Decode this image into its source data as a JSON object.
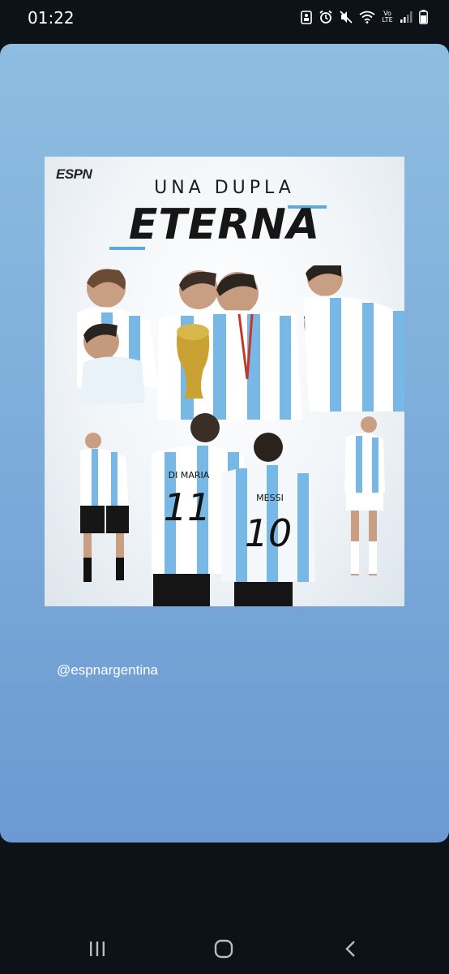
{
  "status_bar": {
    "time": "01:22",
    "network_label": "Vo LTE",
    "icons": [
      "accessibility-icon",
      "alarm-icon",
      "mute-icon",
      "wifi-icon",
      "volte-icon",
      "signal-icon",
      "battery-icon"
    ]
  },
  "story": {
    "poster": {
      "brand": "ESPN",
      "title_line1": "UNA DUPLA",
      "title_line2": "ETERNA",
      "jersey_left_name": "DI MARIA",
      "jersey_left_number": "11",
      "jersey_right_name": "MESSI",
      "jersey_right_number": "10",
      "accent_color": "#5fa8dd"
    },
    "handle": "@espnargentina"
  },
  "nav_bar": {
    "buttons": [
      "recent-apps-icon",
      "home-icon",
      "back-icon"
    ]
  }
}
